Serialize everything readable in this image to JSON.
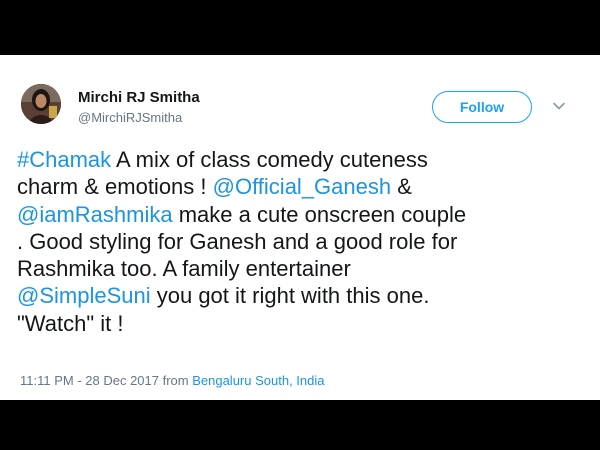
{
  "author": {
    "name": "Mirchi RJ Smitha",
    "handle": "@MirchiRJSmitha"
  },
  "follow_label": "Follow",
  "tweet": {
    "lines": [
      {
        "hashtag": "#Chamak",
        "rest": " A mix of class comedy cuteness"
      },
      {
        "text": "charm & emotions ! ",
        "mention": "@Official_Ganesh",
        "rest": " &"
      },
      {
        "mention": "@iamRashmika",
        "rest": " make a cute onscreen couple"
      },
      {
        "text": ". Good styling for Ganesh and a good role for"
      },
      {
        "text": "Rashmika too. A family entertainer"
      },
      {
        "mention": "@SimpleSuni",
        "rest": " you got it right with this one."
      },
      {
        "text": "\"Watch\" it !"
      }
    ]
  },
  "meta": {
    "timestamp": "11:11 PM - 28 Dec 2017 from ",
    "location": "Bengaluru South, India"
  },
  "colors": {
    "link": "#1b95e0",
    "follow_accent": "#1da1f2",
    "text": "#14171a",
    "muted": "#657786",
    "frame": "#000000"
  },
  "icons": {
    "menu": "chevron-down-icon",
    "avatar": "profile-photo"
  }
}
